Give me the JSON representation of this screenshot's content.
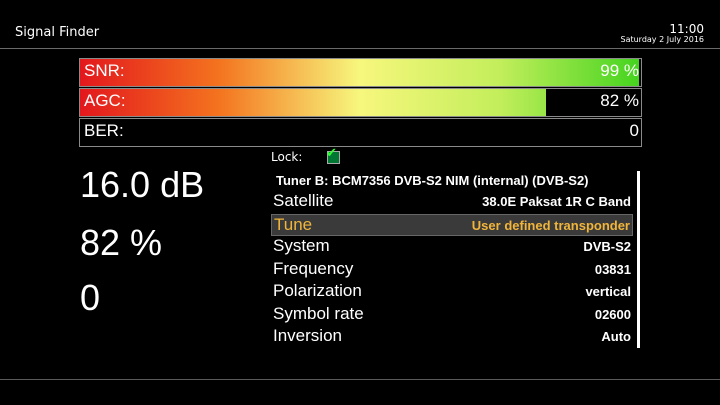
{
  "header": {
    "title": "Signal Finder",
    "time": "11:00",
    "date": "Saturday  2 July 2016"
  },
  "meters": [
    {
      "label": "SNR:",
      "value": "99 %",
      "level": 1.0
    },
    {
      "label": "AGC:",
      "value": "82 %",
      "level": 0.83
    },
    {
      "label": "BER:",
      "value": "0",
      "level": 0
    }
  ],
  "big_values": {
    "snr_db": "16.0 dB",
    "agc": "82 %",
    "ber": "0"
  },
  "lock": {
    "label": "Lock:",
    "checked": true
  },
  "tuner_header": "Tuner B: BCM7356 DVB-S2 NIM (internal) (DVB-S2)",
  "rows": [
    {
      "key": "Satellite",
      "value": "38.0E Paksat 1R C Band"
    },
    {
      "key": "Tune",
      "value": "User defined transponder"
    },
    {
      "key": "System",
      "value": "DVB-S2"
    },
    {
      "key": "Frequency",
      "value": "03831"
    },
    {
      "key": "Polarization",
      "value": "vertical"
    },
    {
      "key": "Symbol rate",
      "value": "02600"
    },
    {
      "key": "Inversion",
      "value": "Auto"
    }
  ],
  "selected_row": "Tune",
  "colors": {
    "selected_text": "#f0b53a",
    "lock_check": "#33ff33"
  }
}
